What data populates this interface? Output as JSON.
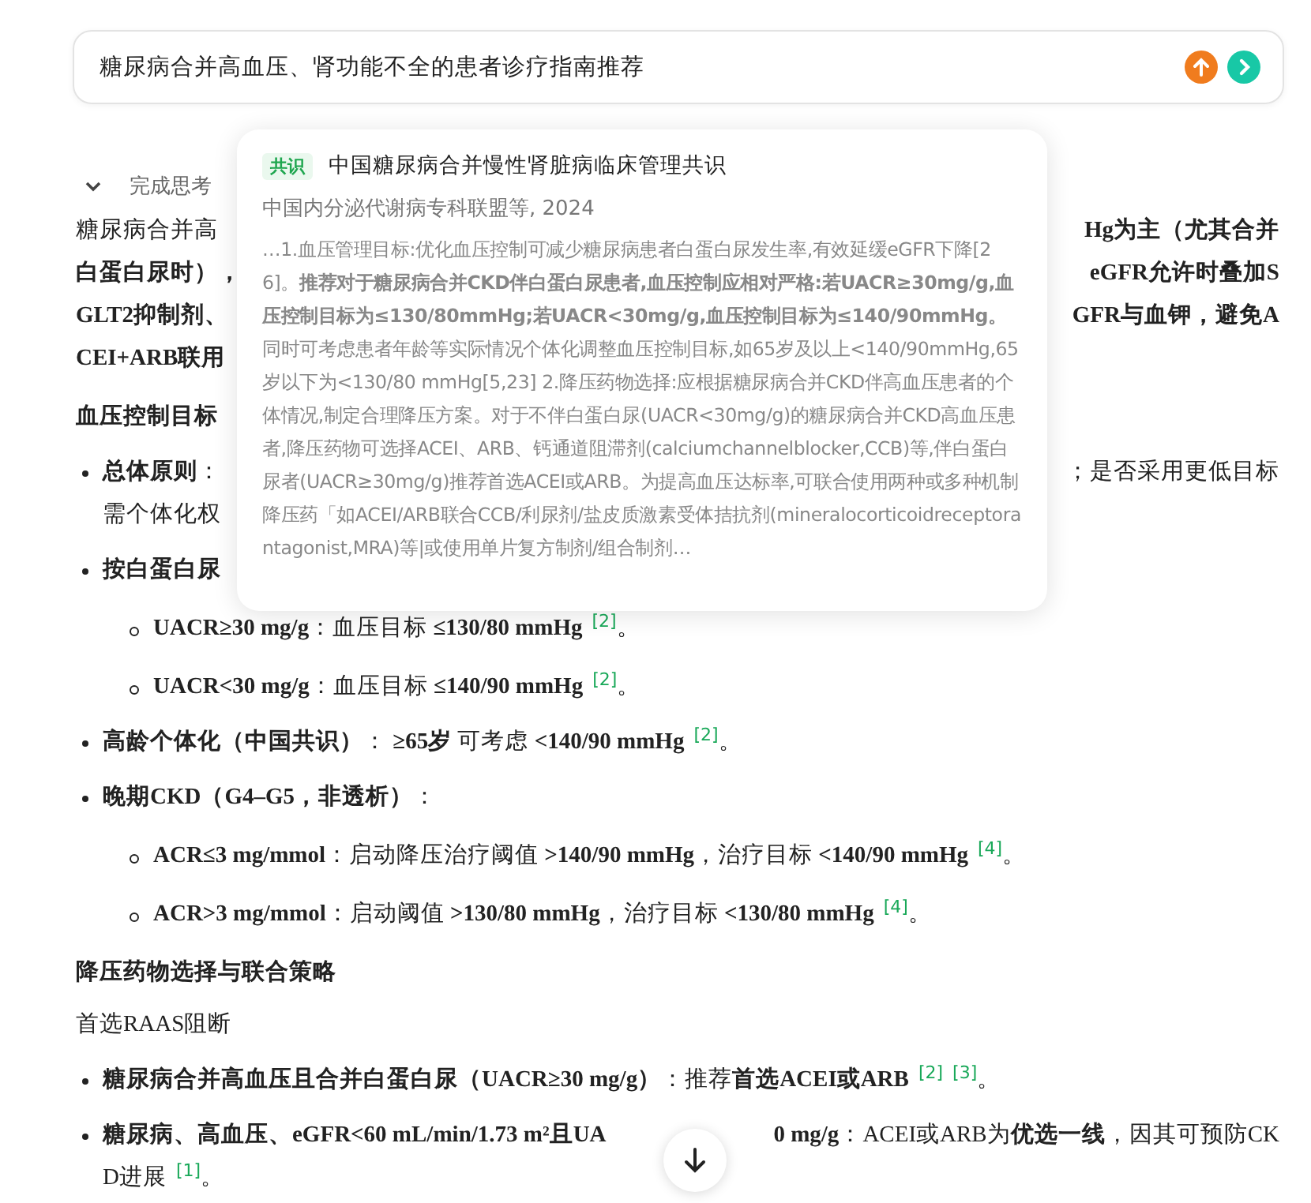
{
  "query": {
    "value": "糖尿病合并高血压、肾功能不全的患者诊疗指南推荐"
  },
  "thinking": {
    "label": "完成思考",
    "expanded": false
  },
  "content": [
    {
      "kind": "para",
      "lines": [
        {
          "left": "糖尿病合并高",
          "right": "**Hg为主（尤其合并**"
        },
        {
          "left": "**白蛋白尿时），**",
          "right": "**eGFR允许时叠加S**"
        },
        {
          "left": "**GLT2抑制剂、**",
          "right": "**GFR与血钾，避免A**"
        },
        {
          "left": "**CEI+ARB联用**"
        }
      ]
    },
    {
      "kind": "heading",
      "lines": [
        {
          "left": "血压控制目标"
        }
      ]
    },
    {
      "kind": "bullet",
      "lines": [
        {
          "left": "**总体原则**：",
          "right": "；是否采用更低目标"
        },
        {
          "left": "需个体化权"
        }
      ]
    },
    {
      "kind": "bullet",
      "lines": [
        {
          "left": "**按白蛋白尿**"
        }
      ]
    },
    {
      "kind": "sub",
      "lines": [
        {
          "left": "**UACR≥30 mg/g**：血压目标 **≤130/80 mmHg**"
        }
      ],
      "refs": [
        "[2]"
      ],
      "end": "。"
    },
    {
      "kind": "sub",
      "lines": [
        {
          "left": "**UACR<30 mg/g**：血压目标 **≤140/90 mmHg**"
        }
      ],
      "refs": [
        "[2]"
      ],
      "end": "。"
    },
    {
      "kind": "bullet",
      "lines": [
        {
          "left": "**高龄个体化（中国共识）**： **≥65岁** 可考虑 **<140/90 mmHg**"
        }
      ],
      "refs": [
        "[2]"
      ],
      "end": "。"
    },
    {
      "kind": "bullet",
      "lines": [
        {
          "left": "**晚期CKD（G4–G5，非透析）**："
        }
      ]
    },
    {
      "kind": "sub",
      "lines": [
        {
          "left": "**ACR≤3 mg/mmol**：启动降压治疗阈值 **>140/90 mmHg**，治疗目标 **<140/90 mmHg**"
        }
      ],
      "refs": [
        "[4]"
      ],
      "end": "。"
    },
    {
      "kind": "sub",
      "lines": [
        {
          "left": "**ACR>3 mg/mmol**：启动阈值 **>130/80 mmHg**，治疗目标 **<130/80 mmHg**"
        }
      ],
      "refs": [
        "[4]"
      ],
      "end": "。"
    },
    {
      "kind": "heading",
      "lines": [
        {
          "left": "降压药物选择与联合策略"
        }
      ]
    },
    {
      "kind": "plain",
      "lines": [
        {
          "left": "首选RAAS阻断"
        }
      ]
    },
    {
      "kind": "bullet",
      "lines": [
        {
          "left": "**糖尿病合并高血压且合并白蛋白尿（UACR≥30 mg/g）**：推荐**首选ACEI或ARB**"
        }
      ],
      "refs": [
        "[2]",
        "[3]"
      ],
      "end": "。"
    },
    {
      "kind": "bullet",
      "lines": [
        {
          "left": "**糖尿病、高血压、eGFR<60 mL/min/1.73 m²且UA**",
          "right": "**0 mg/g**：ACEI或ARB为**优选一线**，因其可预防CK"
        },
        {
          "left": "D进展"
        }
      ],
      "refs": [
        "[1]"
      ],
      "end": "。"
    }
  ],
  "popup": {
    "tag": "共识",
    "title": "中国糖尿病合并慢性肾脏病临床管理共识",
    "source": "中国内分泌代谢病专科联盟等, 2024",
    "excerpt": "…1.血压管理目标:优化血压控制可减少糖尿病患者白蛋白尿发生率,有效延缓eGFR下降[26]。**推荐对于糖尿病合并CKD伴白蛋白尿患者,血压控制应相对严格:若UACR≥30mg/g,血压控制目标为≤130/80mmHg;若UACR<30mg/g,血压控制目标为≤140/90mmHg。**同时可考虑患者年龄等实际情况个体化调整血压控制目标,如65岁及以上<140/90mmHg,65岁以下为<130/80 mmHg[5,23] 2.降压药物选择:应根据糖尿病合并CKD伴高血压患者的个体情况,制定合理降压方案。对于不伴白蛋白尿(UACR<30mg/g)的糖尿病合并CKD高血压患者,降压药物可选择ACEI、ARB、钙通道阻滞剂(calciumchannelblocker,CCB)等,伴白蛋白尿者(UACR≥30mg/g)推荐首选ACEI或ARB。为提高血压达标率,可联合使用两种或多种机制降压药「如ACEI/ARB联合CCB/利尿剂/盐皮质激素受体拮抗剂(mineralocorticoidreceptorantagonist,MRA)等|或使用单片复方制剂/组合制剂…"
  }
}
